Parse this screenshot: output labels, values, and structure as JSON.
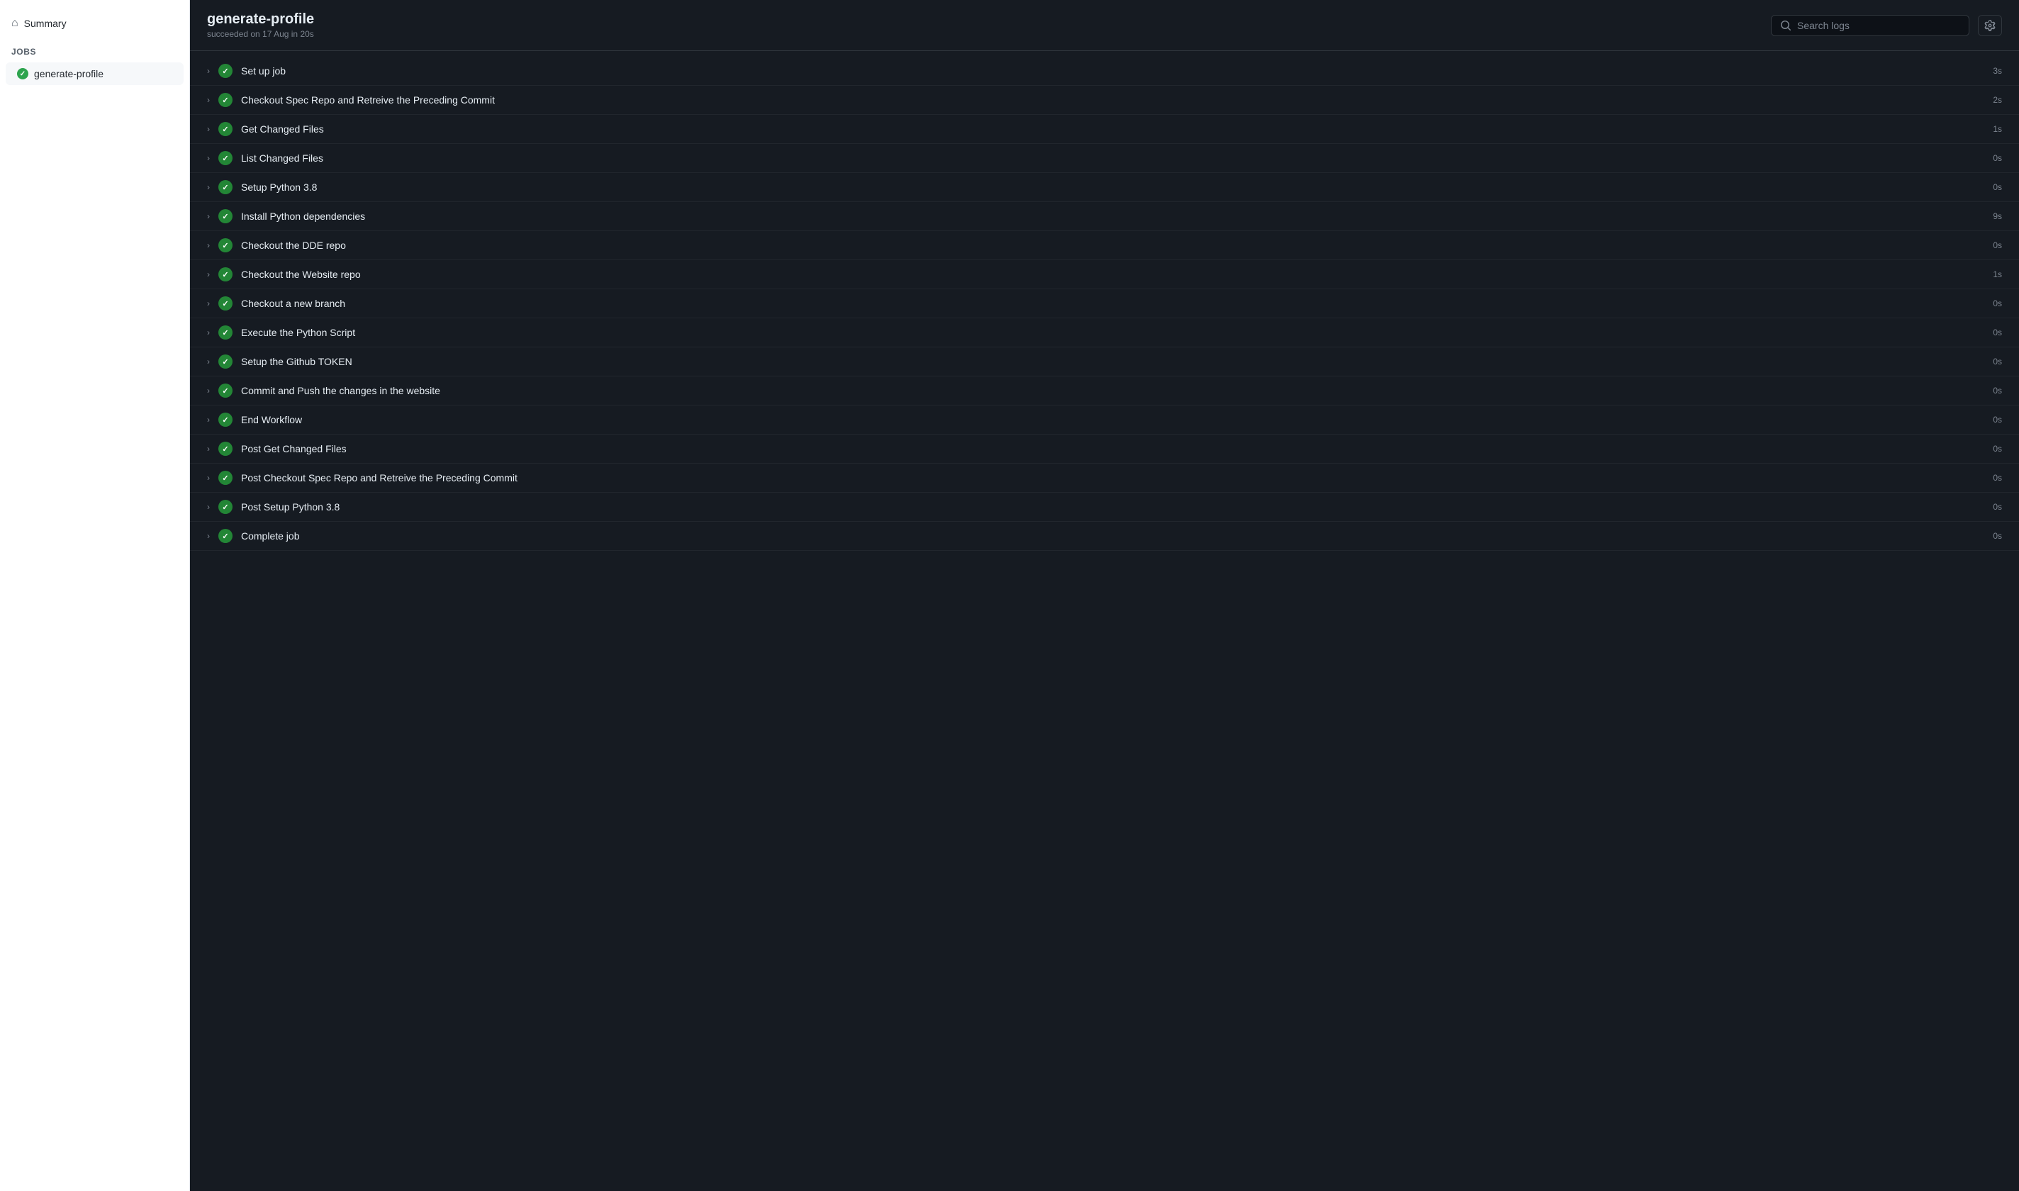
{
  "sidebar": {
    "summary_label": "Summary",
    "jobs_label": "Jobs",
    "job_name": "generate-profile"
  },
  "main": {
    "workflow_title": "generate-profile",
    "workflow_subtitle": "succeeded on 17 Aug in 20s",
    "search_placeholder": "Search logs",
    "steps": [
      {
        "name": "Set up job",
        "duration": "3s"
      },
      {
        "name": "Checkout Spec Repo and Retreive the Preceding Commit",
        "duration": "2s"
      },
      {
        "name": "Get Changed Files",
        "duration": "1s"
      },
      {
        "name": "List Changed Files",
        "duration": "0s"
      },
      {
        "name": "Setup Python 3.8",
        "duration": "0s"
      },
      {
        "name": "Install Python dependencies",
        "duration": "9s"
      },
      {
        "name": "Checkout the DDE repo",
        "duration": "0s"
      },
      {
        "name": "Checkout the Website repo",
        "duration": "1s"
      },
      {
        "name": "Checkout a new branch",
        "duration": "0s"
      },
      {
        "name": "Execute the Python Script",
        "duration": "0s"
      },
      {
        "name": "Setup the Github TOKEN",
        "duration": "0s"
      },
      {
        "name": "Commit and Push the changes in the website",
        "duration": "0s"
      },
      {
        "name": "End Workflow",
        "duration": "0s"
      },
      {
        "name": "Post Get Changed Files",
        "duration": "0s"
      },
      {
        "name": "Post Checkout Spec Repo and Retreive the Preceding Commit",
        "duration": "0s"
      },
      {
        "name": "Post Setup Python 3.8",
        "duration": "0s"
      },
      {
        "name": "Complete job",
        "duration": "0s"
      }
    ]
  }
}
